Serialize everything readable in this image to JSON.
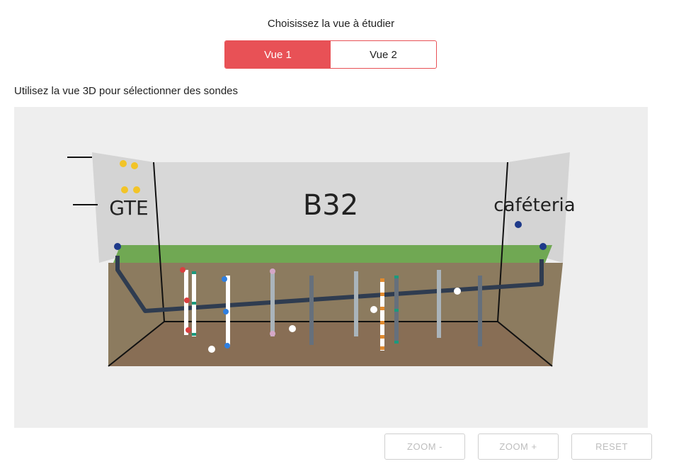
{
  "header": {
    "prompt": "Choisissez la vue à étudier"
  },
  "view_toggle": {
    "view1_label": "Vue 1",
    "view2_label": "Vue 2",
    "selected": "Vue 1"
  },
  "instruction": "Utilisez la vue 3D pour sélectionner des sondes",
  "scene": {
    "center_label": "B32",
    "left_label": "GTE",
    "right_label": "caféteria",
    "colors": {
      "grass": "#70a853",
      "soil_top": "#8b7a5d",
      "soil_bottom": "#8b6a50",
      "pipe": "#2f3c50",
      "accent": "#e85156"
    }
  },
  "controls": {
    "zoom_out_label": "ZOOM -",
    "zoom_in_label": "ZOOM +",
    "reset_label": "RESET"
  }
}
